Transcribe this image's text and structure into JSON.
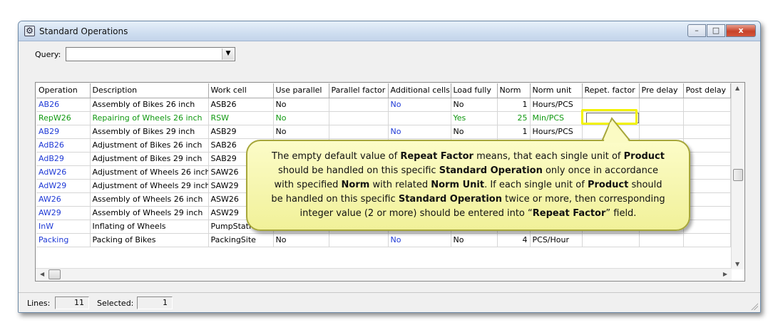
{
  "window": {
    "title": "Standard Operations",
    "buttons": {
      "minimize": "–",
      "maximize": "□",
      "close": "x"
    }
  },
  "query": {
    "label": "Query:",
    "value": ""
  },
  "grid": {
    "columns": [
      "Operation",
      "Description",
      "Work cell",
      "Use parallel",
      "Parallel factor",
      "Additional cells",
      "Load fully",
      "Norm",
      "Norm unit",
      "Repet. factor",
      "Pre delay",
      "Post delay"
    ],
    "rows": [
      {
        "operation": "AB26",
        "description": "Assembly of Bikes 26 inch",
        "work_cell": "ASB26",
        "use_parallel": "No",
        "parallel_factor": "",
        "additional_cells": "No",
        "load_fully": "No",
        "norm": "1",
        "norm_unit": "Hours/PCS",
        "repet_factor": "",
        "pre_delay": "",
        "post_delay": ""
      },
      {
        "operation": "RepW26",
        "description": "Repairing of Wheels 26 inch",
        "work_cell": "RSW",
        "use_parallel": "No",
        "parallel_factor": "",
        "additional_cells": "",
        "load_fully": "Yes",
        "norm": "25",
        "norm_unit": "Min/PCS",
        "repet_factor": "",
        "pre_delay": "",
        "post_delay": ""
      },
      {
        "operation": "AB29",
        "description": "Assembly of Bikes 29 inch",
        "work_cell": "ASB29",
        "use_parallel": "No",
        "parallel_factor": "",
        "additional_cells": "No",
        "load_fully": "No",
        "norm": "1",
        "norm_unit": "Hours/PCS",
        "repet_factor": "",
        "pre_delay": "",
        "post_delay": ""
      },
      {
        "operation": "AdB26",
        "description": "Adjustment of Bikes 26 inch",
        "work_cell": "SAB26",
        "use_parallel": "",
        "parallel_factor": "",
        "additional_cells": "",
        "load_fully": "",
        "norm": "",
        "norm_unit": "",
        "repet_factor": "",
        "pre_delay": "",
        "post_delay": ""
      },
      {
        "operation": "AdB29",
        "description": "Adjustment of Bikes 29 inch",
        "work_cell": "SAB29",
        "use_parallel": "",
        "parallel_factor": "",
        "additional_cells": "",
        "load_fully": "",
        "norm": "",
        "norm_unit": "",
        "repet_factor": "",
        "pre_delay": "",
        "post_delay": ""
      },
      {
        "operation": "AdW26",
        "description": "Adjustment of Wheels 26 inch",
        "work_cell": "SAW26",
        "use_parallel": "",
        "parallel_factor": "",
        "additional_cells": "",
        "load_fully": "",
        "norm": "",
        "norm_unit": "",
        "repet_factor": "",
        "pre_delay": "",
        "post_delay": ""
      },
      {
        "operation": "AdW29",
        "description": "Adjustment of Wheels 29 inch",
        "work_cell": "SAW29",
        "use_parallel": "",
        "parallel_factor": "",
        "additional_cells": "",
        "load_fully": "",
        "norm": "",
        "norm_unit": "",
        "repet_factor": "",
        "pre_delay": "",
        "post_delay": ""
      },
      {
        "operation": "AW26",
        "description": "Assembly of Wheels 26 inch",
        "work_cell": "ASW26",
        "use_parallel": "",
        "parallel_factor": "",
        "additional_cells": "",
        "load_fully": "",
        "norm": "",
        "norm_unit": "",
        "repet_factor": "",
        "pre_delay": "",
        "post_delay": ""
      },
      {
        "operation": "AW29",
        "description": "Assembly of Wheels 29 inch",
        "work_cell": "ASW29",
        "use_parallel": "",
        "parallel_factor": "",
        "additional_cells": "",
        "load_fully": "",
        "norm": "",
        "norm_unit": "",
        "repet_factor": "",
        "pre_delay": "",
        "post_delay": ""
      },
      {
        "operation": "InW",
        "description": "Inflating of Wheels",
        "work_cell": "PumpStati",
        "use_parallel": "",
        "parallel_factor": "",
        "additional_cells": "",
        "load_fully": "",
        "norm": "",
        "norm_unit": "",
        "repet_factor": "",
        "pre_delay": "",
        "post_delay": ""
      },
      {
        "operation": "Packing",
        "description": "Packing of Bikes",
        "work_cell": "PackingSite",
        "use_parallel": "No",
        "parallel_factor": "",
        "additional_cells": "No",
        "load_fully": "No",
        "norm": "4",
        "norm_unit": "PCS/Hour",
        "repet_factor": "",
        "pre_delay": "",
        "post_delay": ""
      }
    ]
  },
  "status": {
    "lines_label": "Lines:",
    "lines_value": "11",
    "selected_label": "Selected:",
    "selected_value": "1"
  },
  "callout": {
    "lines": [
      [
        "The empty default value of ",
        "Repeat Factor",
        " means, that each single unit of ",
        "Product"
      ],
      [
        "should be handled on this specific ",
        "Standard Operation",
        " only once in accordance"
      ],
      [
        "with specified ",
        "Norm",
        " with related ",
        "Norm Unit",
        ".  If each single unit of ",
        "Product",
        " should"
      ],
      [
        "be handled on this specific ",
        "Standard Operation",
        " twice or more, then corresponding"
      ],
      [
        "integer value (2 or more) should be entered into “",
        "Repeat Factor",
        "” field."
      ]
    ]
  },
  "colors": {
    "link_blue": "#1f3ad6",
    "edited_green": "#119911",
    "callout_fill": "#f7f7b0",
    "highlight": "#f2f200"
  }
}
